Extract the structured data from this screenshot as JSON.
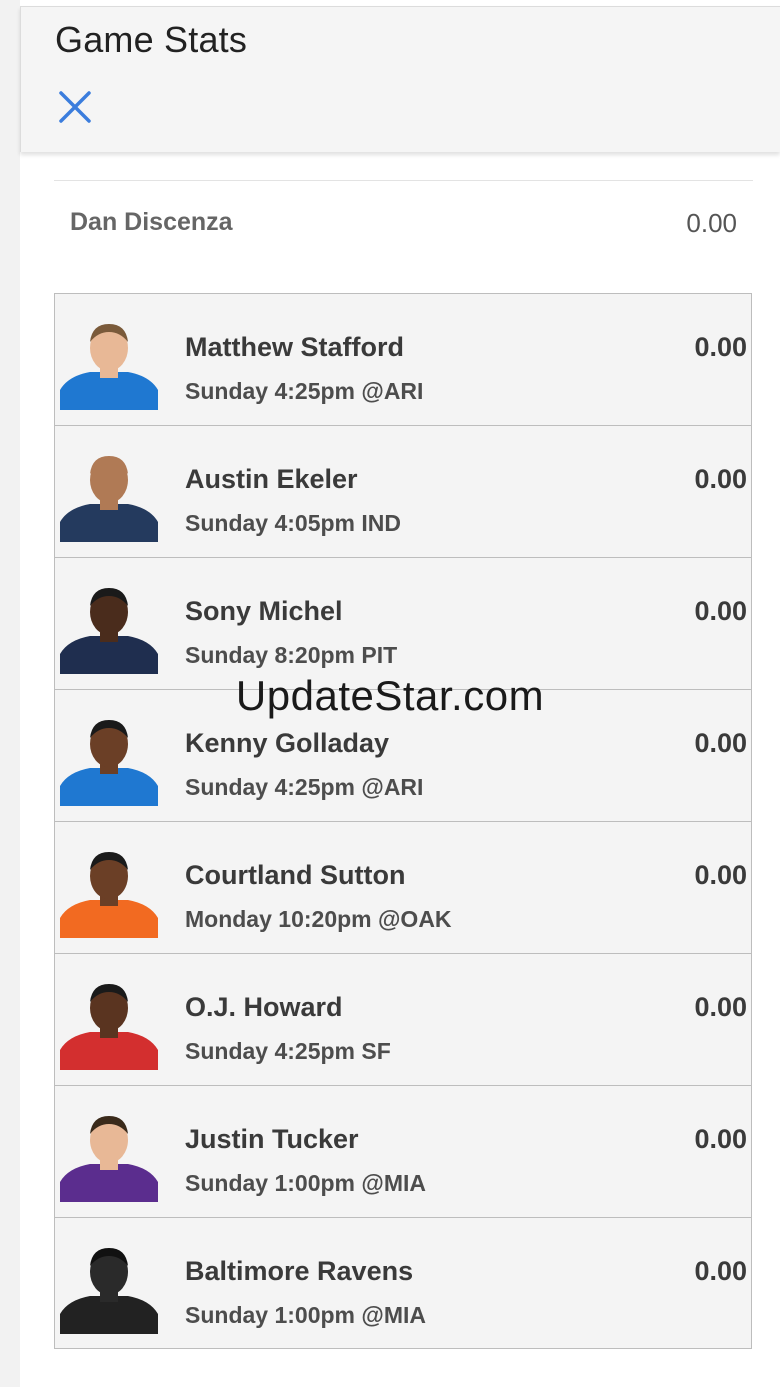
{
  "header": {
    "title": "Game Stats",
    "close_icon": "close-icon",
    "accent_color": "#3b7ddd"
  },
  "owner": {
    "name": "Dan Discenza",
    "score": "0.00"
  },
  "players": [
    {
      "name": "Matthew Stafford",
      "game": "Sunday 4:25pm @ARI",
      "score": "0.00",
      "jersey_color": "#1f78d1",
      "skin": "#e8b896",
      "hair": "#7a5a3a"
    },
    {
      "name": "Austin Ekeler",
      "game": "Sunday 4:05pm IND",
      "score": "0.00",
      "jersey_color": "#243a5e",
      "skin": "#b07a55",
      "hair": "#b07a55"
    },
    {
      "name": "Sony Michel",
      "game": "Sunday 8:20pm PIT",
      "score": "0.00",
      "jersey_color": "#1f2e4f",
      "skin": "#4a2c1c",
      "hair": "#1a1a1a"
    },
    {
      "name": "Kenny Golladay",
      "game": "Sunday 4:25pm @ARI",
      "score": "0.00",
      "jersey_color": "#1f78d1",
      "skin": "#6b3f26",
      "hair": "#1a1a1a"
    },
    {
      "name": "Courtland Sutton",
      "game": "Monday 10:20pm @OAK",
      "score": "0.00",
      "jersey_color": "#f26a21",
      "skin": "#6b3f26",
      "hair": "#1a1a1a"
    },
    {
      "name": "O.J. Howard",
      "game": "Sunday 4:25pm SF",
      "score": "0.00",
      "jersey_color": "#d32f2f",
      "skin": "#5a3420",
      "hair": "#1a1a1a"
    },
    {
      "name": "Justin Tucker",
      "game": "Sunday 1:00pm @MIA",
      "score": "0.00",
      "jersey_color": "#5b2d8e",
      "skin": "#e8b896",
      "hair": "#3a2a1a"
    },
    {
      "name": "Baltimore Ravens",
      "game": "Sunday 1:00pm @MIA",
      "score": "0.00",
      "jersey_color": "#222222",
      "skin": "#2a2a2a",
      "hair": "#111111"
    }
  ],
  "watermark": "UpdateStar.com"
}
